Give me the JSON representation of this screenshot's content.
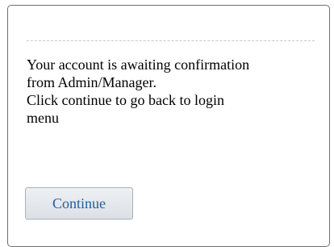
{
  "dialog": {
    "message_lines": [
      "Your account is awaiting confirmation",
      "from Admin/Manager.",
      "Click continue to go back to login",
      "menu"
    ],
    "continue_label": "Continue"
  }
}
